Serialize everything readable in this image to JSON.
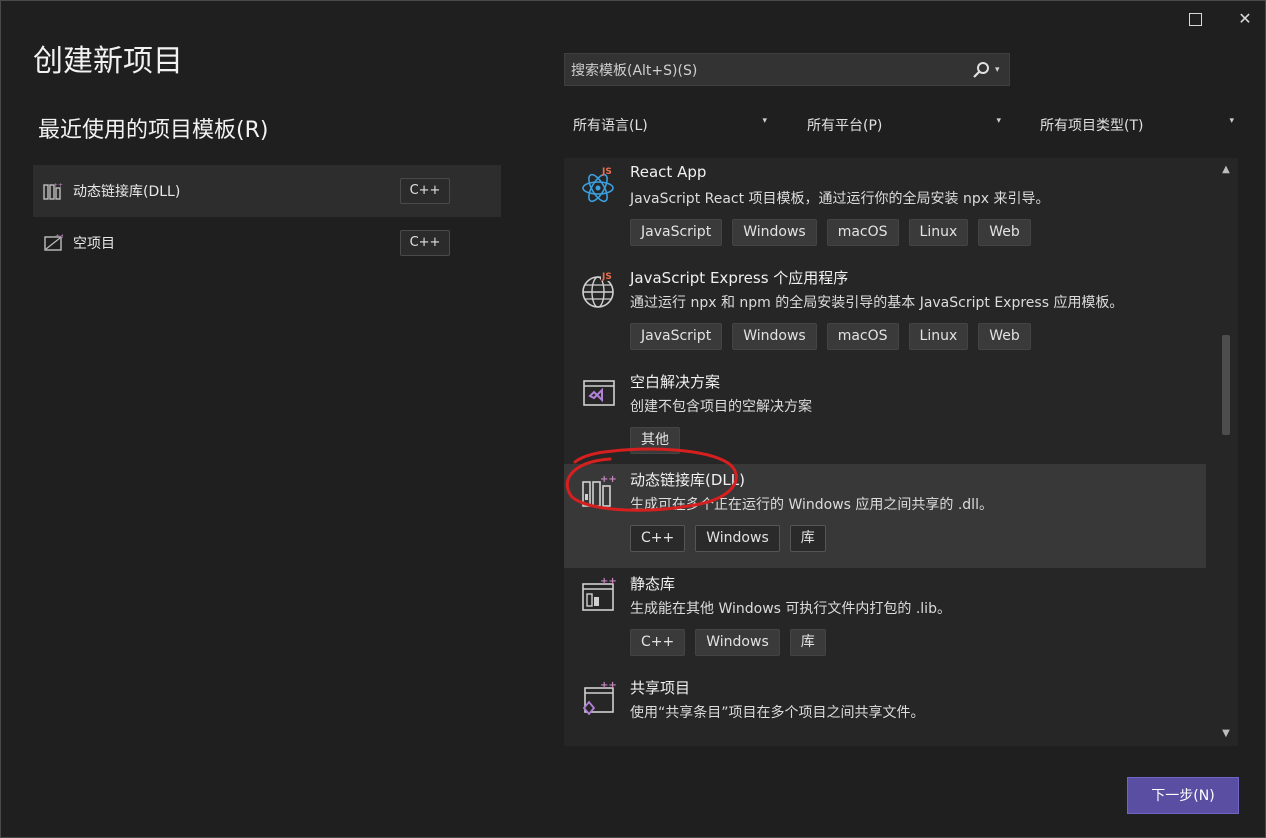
{
  "window": {
    "title": "创建新项目",
    "maximize_icon": "maximize-icon",
    "close_icon": "close-icon",
    "close_glyph": "✕"
  },
  "recent": {
    "heading": "最近使用的项目模板(R)",
    "items": [
      {
        "label": "动态链接库(DLL)",
        "tag": "C++",
        "icon": "dll-project-icon"
      },
      {
        "label": "空项目",
        "tag": "C++",
        "icon": "empty-project-icon"
      }
    ]
  },
  "search": {
    "placeholder": "搜索模板(Alt+S)(S)",
    "icon": "search-icon",
    "dropdown_glyph": "▾"
  },
  "filters": [
    {
      "label": "所有语言(L)"
    },
    {
      "label": "所有平台(P)"
    },
    {
      "label": "所有项目类型(T)"
    }
  ],
  "filter_caret": "▾",
  "templates": [
    {
      "name": "React App",
      "description": "JavaScript React 项目模板，通过运行你的全局安装 npx 来引导。",
      "tags": [
        "JavaScript",
        "Windows",
        "macOS",
        "Linux",
        "Web"
      ],
      "icon": "react-icon"
    },
    {
      "name": "JavaScript Express 个应用程序",
      "description": "通过运行 npx 和 npm 的全局安装引导的基本 JavaScript Express 应用模板。",
      "tags": [
        "JavaScript",
        "Windows",
        "macOS",
        "Linux",
        "Web"
      ],
      "icon": "globe-js-icon"
    },
    {
      "name": "空白解决方案",
      "description": "创建不包含项目的空解决方案",
      "tags": [
        "其他"
      ],
      "icon": "visual-studio-solution-icon"
    },
    {
      "name": "动态链接库(DLL)",
      "description": "生成可在多个正在运行的 Windows 应用之间共享的 .dll。",
      "tags": [
        "C++",
        "Windows",
        "库"
      ],
      "icon": "dll-library-icon"
    },
    {
      "name": "静态库",
      "description": "生成能在其他 Windows 可执行文件内打包的 .lib。",
      "tags": [
        "C++",
        "Windows",
        "库"
      ],
      "icon": "static-library-icon"
    },
    {
      "name": "共享项目",
      "description": "使用“共享条目”项目在多个项目之间共享文件。",
      "tags": [],
      "icon": "shared-project-icon"
    }
  ],
  "scrollbar": {
    "up": "▲",
    "down": "▼"
  },
  "next_button": "下一步(N)",
  "colors": {
    "accent": "#5a4ea3",
    "annotation": "#d61f1f",
    "background": "#1f1f1f"
  }
}
